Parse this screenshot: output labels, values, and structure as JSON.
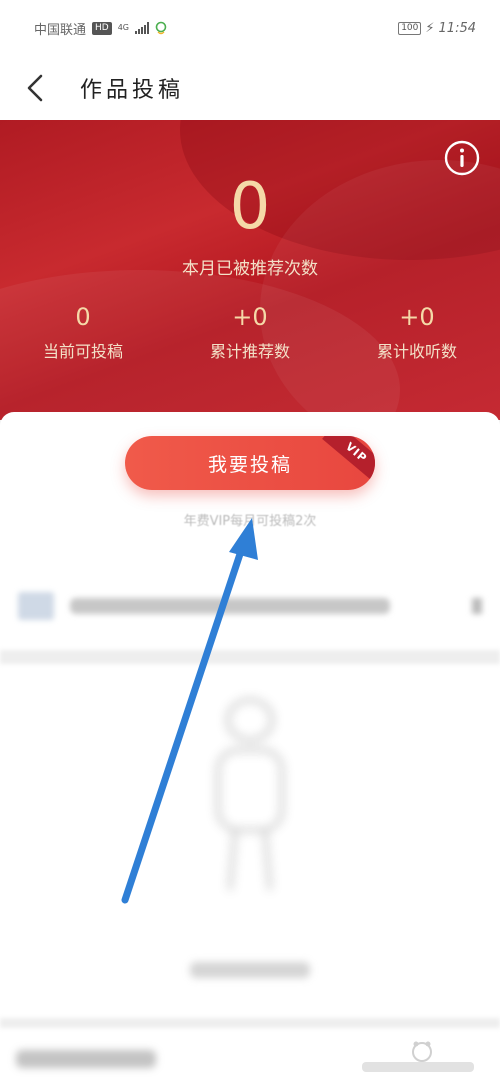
{
  "status_bar": {
    "carrier": "中国联通",
    "hd": "HD",
    "network": "4G",
    "battery": "100",
    "time": "11:54"
  },
  "header": {
    "title": "作品投稿"
  },
  "banner": {
    "recommend_count": "0",
    "recommend_label": "本月已被推荐次数",
    "stats": [
      {
        "value": "0",
        "label": "当前可投稿"
      },
      {
        "value": "+0",
        "label": "累计推荐数"
      },
      {
        "value": "+0",
        "label": "累计收听数"
      }
    ]
  },
  "submit": {
    "label": "我要投稿",
    "vip_badge": "VIP",
    "note": "年费VIP每月可投稿2次"
  },
  "colors": {
    "banner_red": "#c0232b",
    "gold_text": "#f5d9a8",
    "button_red": "#e8473f",
    "arrow_blue": "#2f7fd6"
  }
}
